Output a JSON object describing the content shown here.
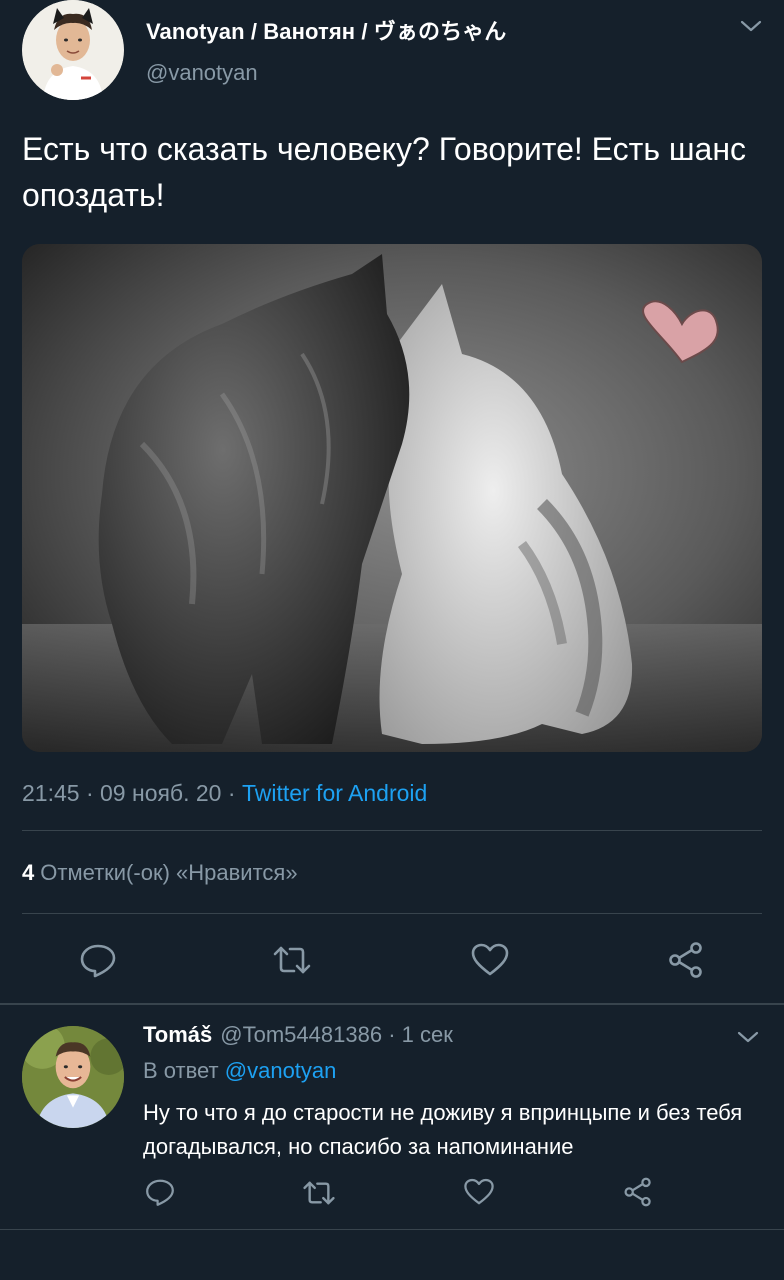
{
  "tweet": {
    "display_name": "Vanotyan / Ванотян / ヴぁのちゃん",
    "handle": "@vanotyan",
    "text": "Есть что сказать человеку? Говорите! Есть шанс опоздать!",
    "media": {
      "description_icon": "image",
      "heart_color": "#d9a2a6"
    },
    "time": "21:45",
    "date": "09 нояб. 20",
    "separator": "·",
    "source": "Twitter for Android",
    "likes_count": "4",
    "likes_label": "Отметки(-ок) «Нравится»"
  },
  "actions": {
    "reply_icon": "reply-icon",
    "retweet_icon": "retweet-icon",
    "like_icon": "heart-icon",
    "share_icon": "share-icon"
  },
  "reply": {
    "display_name": "Tomáš",
    "handle": "@Tom54481386",
    "separator": "·",
    "time": "1 сек",
    "replying_prefix": "В ответ",
    "replying_mention": "@vanotyan",
    "text": "Ну то что я до старости не доживу я впринцыпе и без тебя догадывался, но спасибо за напоминание"
  },
  "colors": {
    "background": "#15202b",
    "accent": "#1da1f2",
    "secondary_text": "#8899a6",
    "divider": "#38444d"
  }
}
